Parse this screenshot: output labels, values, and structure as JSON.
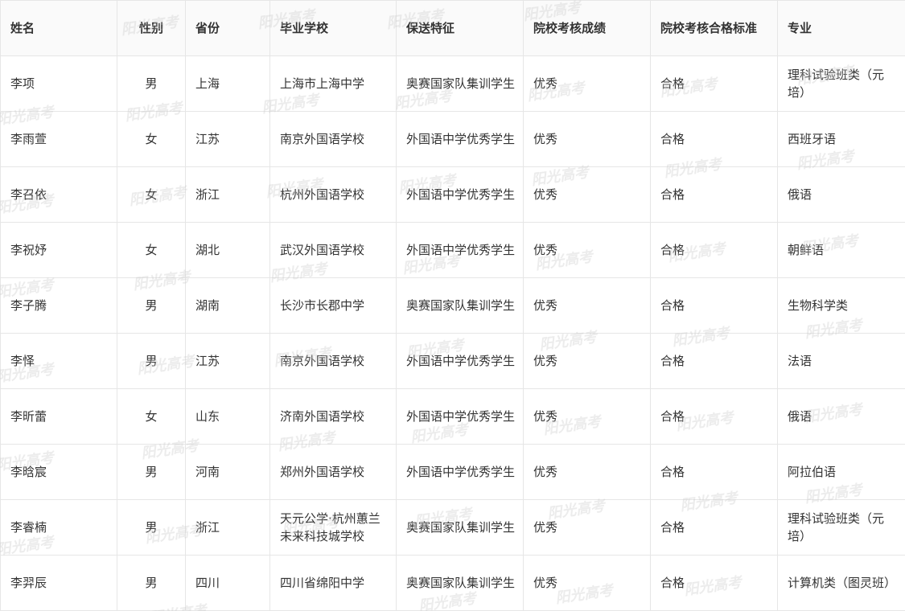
{
  "watermark": "阳光高考",
  "columns": [
    "姓名",
    "性别",
    "省份",
    "毕业学校",
    "保送特征",
    "院校考核成绩",
    "院校考核合格标准",
    "专业"
  ],
  "rows": [
    [
      "李项",
      "男",
      "上海",
      "上海市上海中学",
      "奥赛国家队集训学生",
      "优秀",
      "合格",
      "理科试验班类（元培）"
    ],
    [
      "李雨萱",
      "女",
      "江苏",
      "南京外国语学校",
      "外国语中学优秀学生",
      "优秀",
      "合格",
      "西班牙语"
    ],
    [
      "李召依",
      "女",
      "浙江",
      "杭州外国语学校",
      "外国语中学优秀学生",
      "优秀",
      "合格",
      "俄语"
    ],
    [
      "李祝妤",
      "女",
      "湖北",
      "武汉外国语学校",
      "外国语中学优秀学生",
      "优秀",
      "合格",
      "朝鲜语"
    ],
    [
      "李子腾",
      "男",
      "湖南",
      "长沙市长郡中学",
      "奥赛国家队集训学生",
      "优秀",
      "合格",
      "生物科学类"
    ],
    [
      "李怿",
      "男",
      "江苏",
      "南京外国语学校",
      "外国语中学优秀学生",
      "优秀",
      "合格",
      "法语"
    ],
    [
      "李昕蕾",
      "女",
      "山东",
      "济南外国语学校",
      "外国语中学优秀学生",
      "优秀",
      "合格",
      "俄语"
    ],
    [
      "李晗宸",
      "男",
      "河南",
      "郑州外国语学校",
      "外国语中学优秀学生",
      "优秀",
      "合格",
      "阿拉伯语"
    ],
    [
      "李睿楠",
      "男",
      "浙江",
      "天元公学·杭州蕙兰未来科技城学校",
      "奥赛国家队集训学生",
      "优秀",
      "合格",
      "理科试验班类（元培）"
    ],
    [
      "李羿辰",
      "男",
      "四川",
      "四川省绵阳中学",
      "奥赛国家队集训学生",
      "优秀",
      "合格",
      "计算机类（图灵班）"
    ]
  ]
}
